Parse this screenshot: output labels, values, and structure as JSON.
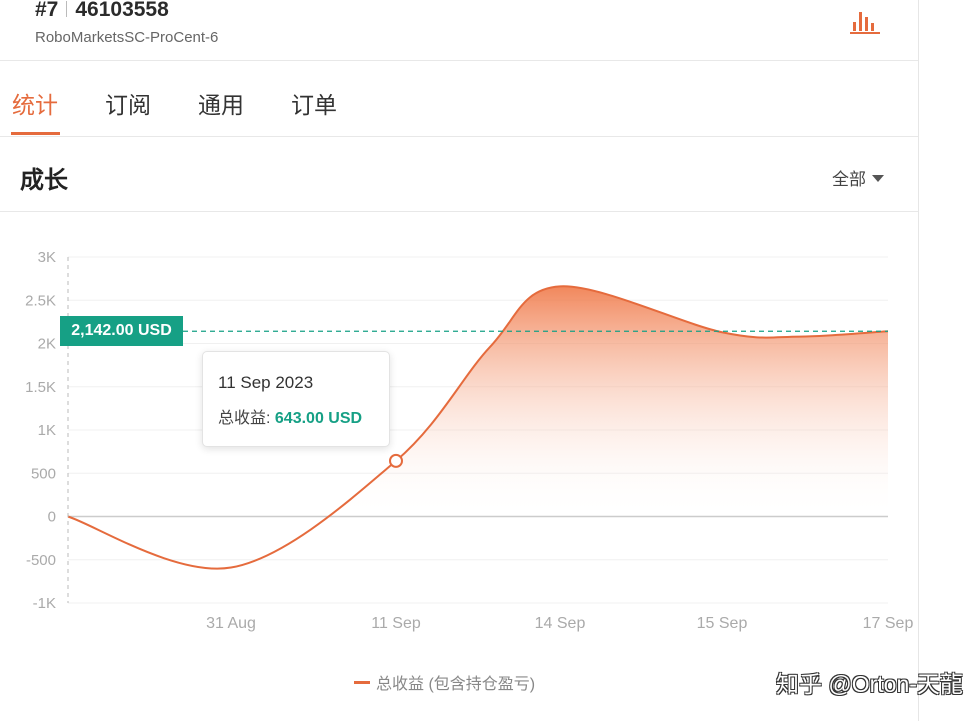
{
  "header": {
    "rank": "#7",
    "account_id": "46103558",
    "server": "RoboMarketsSC-ProCent-6",
    "chart_icon": "bar-chart-icon"
  },
  "tabs": [
    {
      "label": "统计",
      "active": true
    },
    {
      "label": "订阅",
      "active": false
    },
    {
      "label": "通用",
      "active": false
    },
    {
      "label": "订单",
      "active": false
    }
  ],
  "section": {
    "title": "成长",
    "filter_label": "全部",
    "filter_icon": "caret-down-icon"
  },
  "tooltip": {
    "date": "11 Sep 2023",
    "label": "总收益:",
    "value": "643.00 USD"
  },
  "current_value_badge": "2,142.00 USD",
  "legend_label": "总收益 (包含持仓盈亏)",
  "watermark": "知乎 @Orton-天龍",
  "colors": {
    "accent": "#e56b3d",
    "positive": "#16a085"
  },
  "chart_data": {
    "type": "area",
    "title": "",
    "xlabel": "",
    "ylabel": "",
    "y_ticks": [
      "3K",
      "2.5K",
      "2K",
      "1.5K",
      "1K",
      "500",
      "0",
      "-500",
      "-1K"
    ],
    "ylim": [
      -1000,
      3000
    ],
    "x_ticks": [
      "31 Aug",
      "11 Sep",
      "14 Sep",
      "15 Sep",
      "17 Sep"
    ],
    "series": [
      {
        "values": [
          {
            "x": "start",
            "y": 0
          },
          {
            "x": "31 Aug",
            "y": -590
          },
          {
            "x": "11 Sep",
            "y": 643
          },
          {
            "x": "12 Sep",
            "y": 1960
          },
          {
            "x": "14 Sep",
            "y": 2660
          },
          {
            "x": "15 Sep",
            "y": 2130
          },
          {
            "x": "16 Sep",
            "y": 2080
          },
          {
            "x": "17 Sep",
            "y": 2142
          }
        ]
      }
    ],
    "reference_line": 2142,
    "highlighted_point": {
      "x": "11 Sep",
      "y": 643
    },
    "grid": true
  }
}
